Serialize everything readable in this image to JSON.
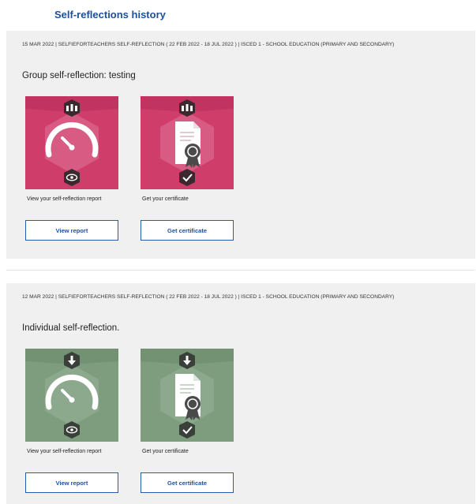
{
  "page": {
    "title": "Self-reflections history"
  },
  "theme": {
    "group_tile": "#cf3e6b",
    "group_tile_dark": "#b72f5a",
    "individual_tile": "#7e9c7e",
    "individual_tile_dark": "#6c8a6c",
    "link_color": "#1e4f9c"
  },
  "entries": [
    {
      "meta": "15 MAR 2022 | SELFIEFORTEACHERS SELF-REFLECTION ( 22 FEB 2022 - 18 JUL 2022 ) | ISCED 1 - SCHOOL EDUCATION (PRIMARY AND SECONDARY)",
      "title": "Group self-reflection: testing",
      "type": "group",
      "cards": [
        {
          "icon": "speedometer-icon",
          "badge_top": "group-icon",
          "badge_bottom": "eye-icon",
          "caption": "View your self-reflection report",
          "button": "View report"
        },
        {
          "icon": "certificate-icon",
          "badge_top": "group-icon",
          "badge_bottom": "check-icon",
          "caption": "Get your certificate",
          "button": "Get certificate"
        }
      ]
    },
    {
      "meta": "12 MAR 2022 | SELFIEFORTEACHERS SELF-REFLECTION ( 22 FEB 2022 - 18 JUL 2022 ) | ISCED 1 - SCHOOL EDUCATION (PRIMARY AND SECONDARY)",
      "title": "Individual self-reflection.",
      "type": "individual",
      "cards": [
        {
          "icon": "speedometer-icon",
          "badge_top": "person-icon",
          "badge_bottom": "eye-icon",
          "caption": "View your self-reflection report",
          "button": "View report"
        },
        {
          "icon": "certificate-icon",
          "badge_top": "person-icon",
          "badge_bottom": "check-icon",
          "caption": "Get your certificate",
          "button": "Get certificate"
        }
      ]
    }
  ]
}
